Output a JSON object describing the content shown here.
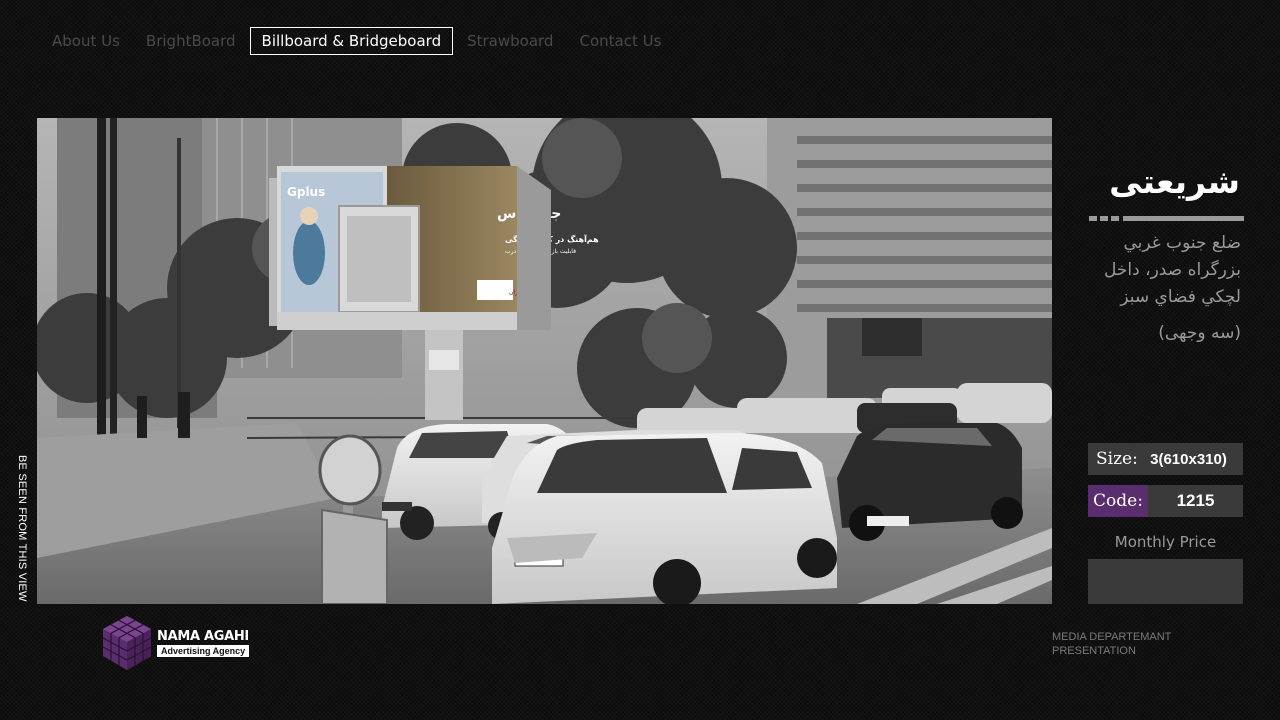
{
  "nav": {
    "items": [
      {
        "label": "About Us",
        "active": false
      },
      {
        "label": "BrightBoard",
        "active": false
      },
      {
        "label": "Billboard & Bridgeboard",
        "active": true
      },
      {
        "label": "Strawboard",
        "active": false
      },
      {
        "label": "Contact Us",
        "active": false
      }
    ]
  },
  "photo": {
    "caption": "BE SEEN FROM THIS VIEW",
    "billboard_brand_left": "Gplus",
    "billboard_title": "جی پلاس",
    "billboard_slogan": "هم‌آهنگ در کار و زندگی",
    "billboard_subline": "قابلیت باز شدن خودکار درب",
    "billboard_logo": "گلدیران"
  },
  "panel": {
    "location_name": "شریعتی",
    "address": "ضلع جنوب غربي بزرگراه صدر، داخل لچكي فضاي سبز",
    "sides": "(سه وجهی)",
    "size_label": "Size:",
    "size_value": "3(610x310)",
    "code_label": "Code:",
    "code_value": "1215",
    "price_label": "Monthly Price",
    "price_value": ""
  },
  "footer": {
    "logo_name": "NAMA AGAHI",
    "logo_tagline": "Advertising Agency",
    "note_line1": "MEDIA DEPARTEMANT",
    "note_line2": "PRESENTATION"
  },
  "colors": {
    "background": "#0d0d0d",
    "accent_purple": "#5a2d6e",
    "panel_box": "#3a3a3a",
    "muted_text": "#9a9a9a",
    "nav_inactive": "#4a4a4a"
  }
}
